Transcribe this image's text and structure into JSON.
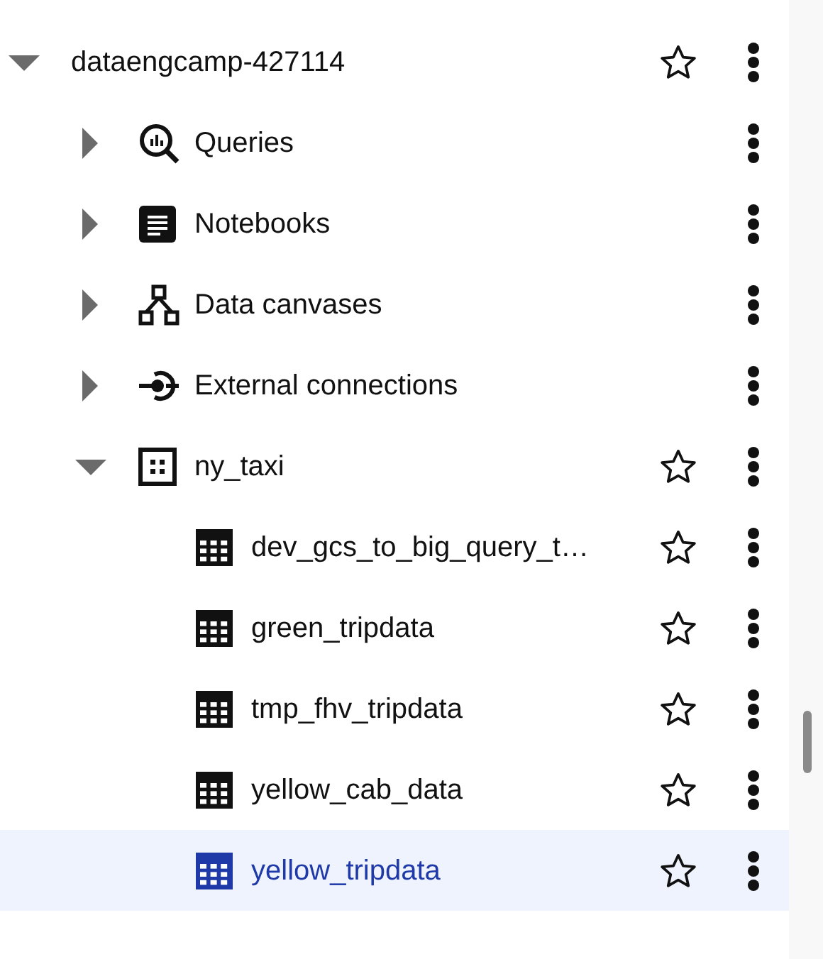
{
  "tree": [
    {
      "label": "dataengcamp-427114",
      "kind": "project",
      "expanded": true,
      "selected": false,
      "children": [
        {
          "label": "Queries",
          "kind": "queries",
          "expanded": false,
          "selected": false
        },
        {
          "label": "Notebooks",
          "kind": "notebooks",
          "expanded": false,
          "selected": false
        },
        {
          "label": "Data canvases",
          "kind": "canvases",
          "expanded": false,
          "selected": false
        },
        {
          "label": "External connections",
          "kind": "connections",
          "expanded": false,
          "selected": false
        },
        {
          "label": "ny_taxi",
          "kind": "dataset",
          "expanded": true,
          "selected": false,
          "children": [
            {
              "label": "dev_gcs_to_big_query_t…",
              "kind": "table",
              "selected": false
            },
            {
              "label": "green_tripdata",
              "kind": "table",
              "selected": false
            },
            {
              "label": "tmp_fhv_tripdata",
              "kind": "table",
              "selected": false
            },
            {
              "label": "yellow_cab_data",
              "kind": "table",
              "selected": false
            },
            {
              "label": "yellow_tripdata",
              "kind": "table",
              "selected": true
            }
          ]
        }
      ]
    }
  ]
}
